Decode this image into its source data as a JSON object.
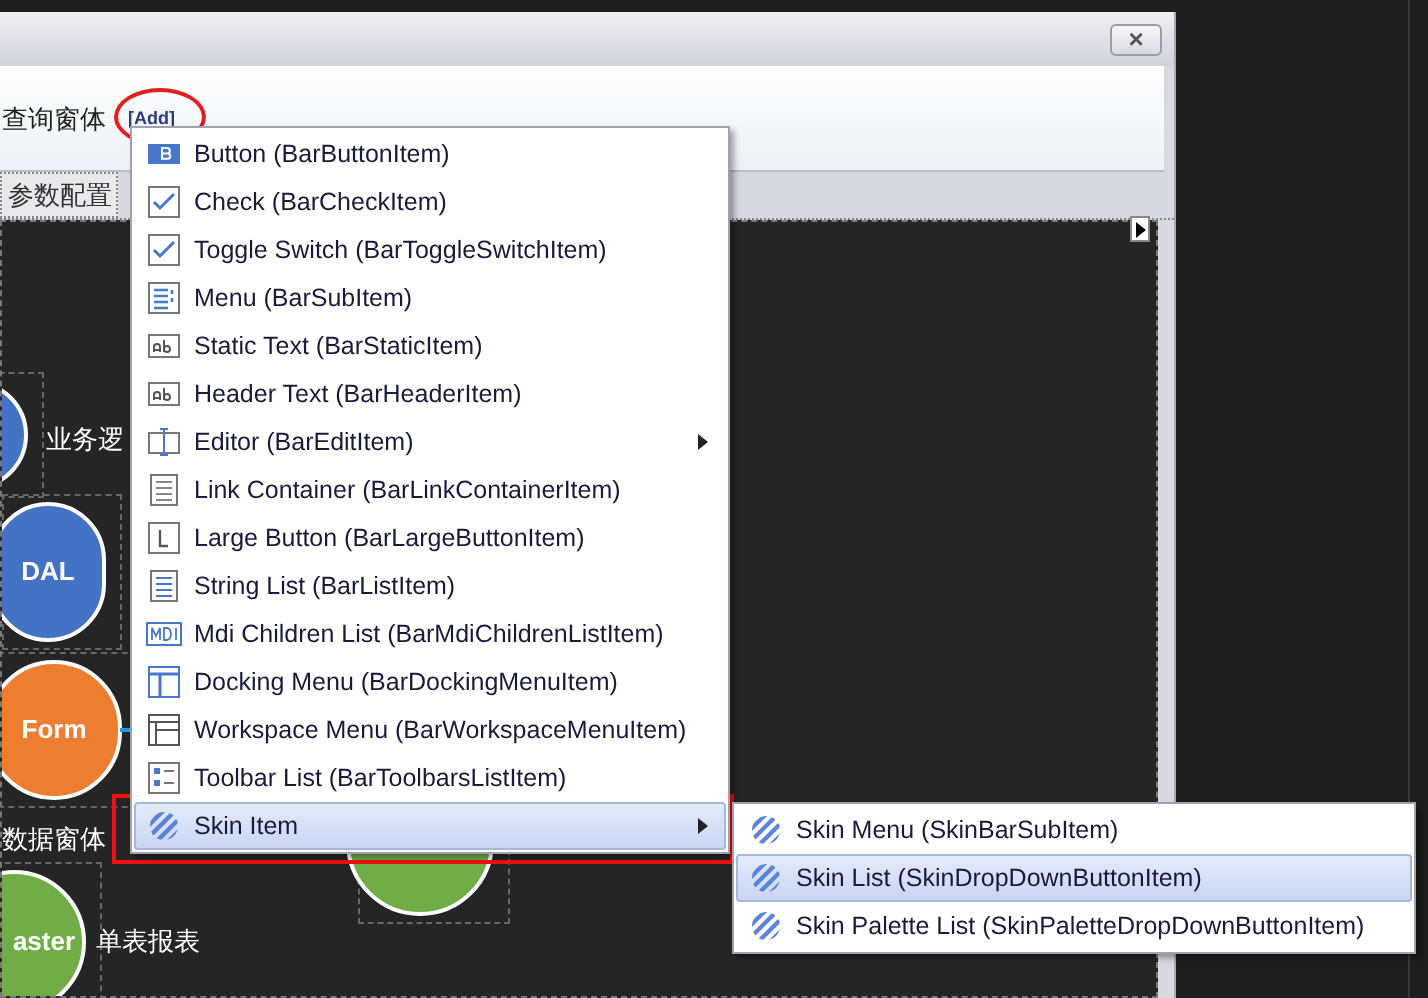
{
  "window": {
    "close_label": "×"
  },
  "header": {
    "title": "查询窗体",
    "add_label": "[Add]"
  },
  "tabs": [
    {
      "label": "参数配置",
      "selected": true
    }
  ],
  "canvas": {
    "nodes": [
      {
        "color": "#4472c4",
        "caption": "业务逻"
      },
      {
        "label": "DAL",
        "color": "#4472c4"
      },
      {
        "label": "Form",
        "color": "#ed7d31",
        "caption": "数据窗体"
      },
      {
        "label": "aster",
        "color": "#70ad47",
        "caption": "单表报表"
      },
      {
        "color": "#70ad47"
      }
    ]
  },
  "menu": {
    "items": [
      {
        "label": "Button (BarButtonItem)",
        "selected": false,
        "has_submenu": false
      },
      {
        "label": "Check (BarCheckItem)",
        "selected": false,
        "has_submenu": false
      },
      {
        "label": "Toggle Switch (BarToggleSwitchItem)",
        "selected": false,
        "has_submenu": false
      },
      {
        "label": "Menu (BarSubItem)",
        "selected": false,
        "has_submenu": false
      },
      {
        "label": "Static Text (BarStaticItem)",
        "selected": false,
        "has_submenu": false
      },
      {
        "label": "Header Text (BarHeaderItem)",
        "selected": false,
        "has_submenu": false
      },
      {
        "label": "Editor (BarEditItem)",
        "selected": false,
        "has_submenu": true
      },
      {
        "label": "Link Container (BarLinkContainerItem)",
        "selected": false,
        "has_submenu": false
      },
      {
        "label": "Large Button (BarLargeButtonItem)",
        "selected": false,
        "has_submenu": false
      },
      {
        "label": "String List (BarListItem)",
        "selected": false,
        "has_submenu": false
      },
      {
        "label": "Mdi Children List (BarMdiChildrenListItem)",
        "selected": false,
        "has_submenu": false
      },
      {
        "label": "Docking Menu (BarDockingMenuItem)",
        "selected": false,
        "has_submenu": false
      },
      {
        "label": "Workspace Menu (BarWorkspaceMenuItem)",
        "selected": false,
        "has_submenu": false
      },
      {
        "label": "Toolbar List (BarToolbarsListItem)",
        "selected": false,
        "has_submenu": false
      },
      {
        "label": "Skin Item",
        "selected": true,
        "has_submenu": true
      }
    ]
  },
  "submenu": {
    "items": [
      {
        "label": "Skin Menu (SkinBarSubItem)",
        "selected": false
      },
      {
        "label": "Skin List (SkinDropDownButtonItem)",
        "selected": true
      },
      {
        "label": "Skin Palette List (SkinPaletteDropDownButtonItem)",
        "selected": false
      }
    ]
  }
}
